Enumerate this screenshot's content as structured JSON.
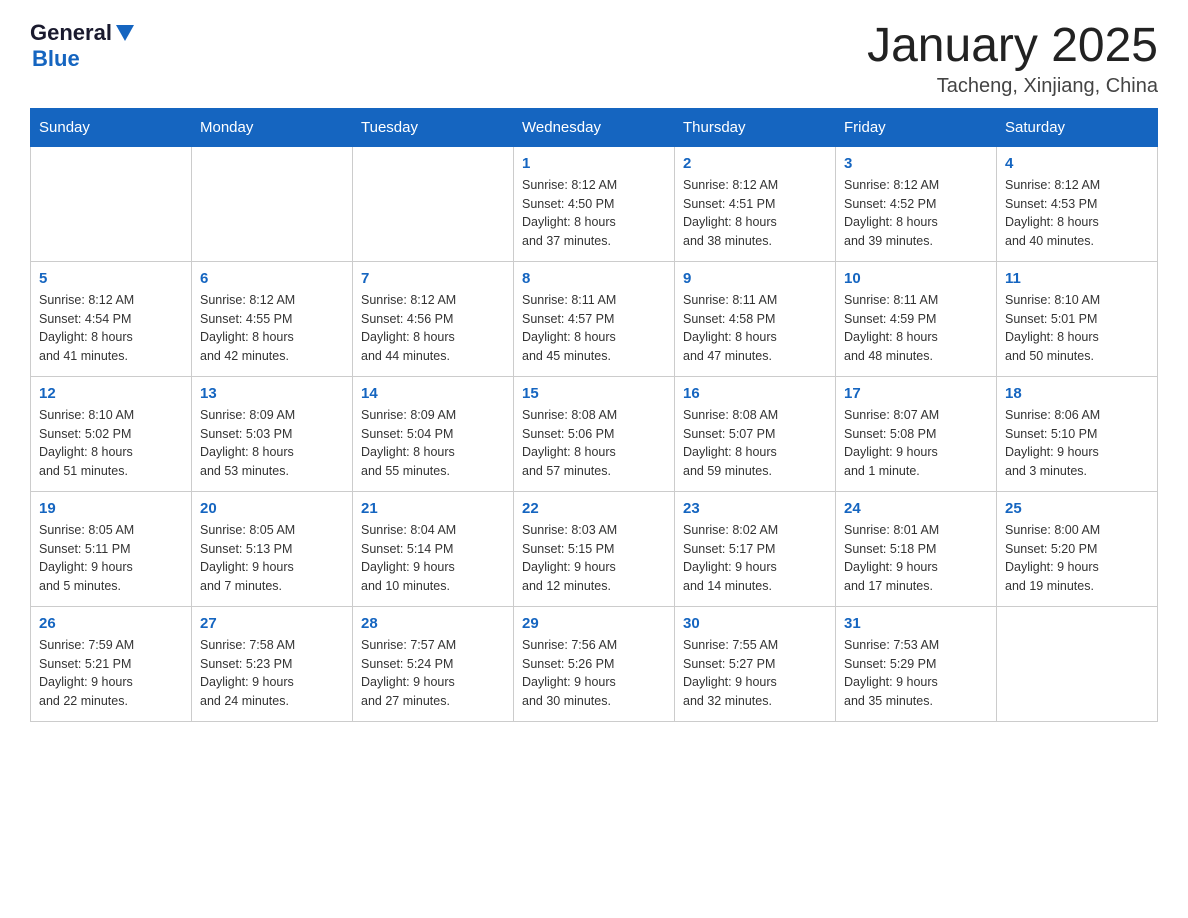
{
  "header": {
    "logo_general": "General",
    "logo_blue": "Blue",
    "title": "January 2025",
    "subtitle": "Tacheng, Xinjiang, China"
  },
  "days_of_week": [
    "Sunday",
    "Monday",
    "Tuesday",
    "Wednesday",
    "Thursday",
    "Friday",
    "Saturday"
  ],
  "weeks": [
    {
      "days": [
        {
          "number": "",
          "info": ""
        },
        {
          "number": "",
          "info": ""
        },
        {
          "number": "",
          "info": ""
        },
        {
          "number": "1",
          "info": "Sunrise: 8:12 AM\nSunset: 4:50 PM\nDaylight: 8 hours\nand 37 minutes."
        },
        {
          "number": "2",
          "info": "Sunrise: 8:12 AM\nSunset: 4:51 PM\nDaylight: 8 hours\nand 38 minutes."
        },
        {
          "number": "3",
          "info": "Sunrise: 8:12 AM\nSunset: 4:52 PM\nDaylight: 8 hours\nand 39 minutes."
        },
        {
          "number": "4",
          "info": "Sunrise: 8:12 AM\nSunset: 4:53 PM\nDaylight: 8 hours\nand 40 minutes."
        }
      ]
    },
    {
      "days": [
        {
          "number": "5",
          "info": "Sunrise: 8:12 AM\nSunset: 4:54 PM\nDaylight: 8 hours\nand 41 minutes."
        },
        {
          "number": "6",
          "info": "Sunrise: 8:12 AM\nSunset: 4:55 PM\nDaylight: 8 hours\nand 42 minutes."
        },
        {
          "number": "7",
          "info": "Sunrise: 8:12 AM\nSunset: 4:56 PM\nDaylight: 8 hours\nand 44 minutes."
        },
        {
          "number": "8",
          "info": "Sunrise: 8:11 AM\nSunset: 4:57 PM\nDaylight: 8 hours\nand 45 minutes."
        },
        {
          "number": "9",
          "info": "Sunrise: 8:11 AM\nSunset: 4:58 PM\nDaylight: 8 hours\nand 47 minutes."
        },
        {
          "number": "10",
          "info": "Sunrise: 8:11 AM\nSunset: 4:59 PM\nDaylight: 8 hours\nand 48 minutes."
        },
        {
          "number": "11",
          "info": "Sunrise: 8:10 AM\nSunset: 5:01 PM\nDaylight: 8 hours\nand 50 minutes."
        }
      ]
    },
    {
      "days": [
        {
          "number": "12",
          "info": "Sunrise: 8:10 AM\nSunset: 5:02 PM\nDaylight: 8 hours\nand 51 minutes."
        },
        {
          "number": "13",
          "info": "Sunrise: 8:09 AM\nSunset: 5:03 PM\nDaylight: 8 hours\nand 53 minutes."
        },
        {
          "number": "14",
          "info": "Sunrise: 8:09 AM\nSunset: 5:04 PM\nDaylight: 8 hours\nand 55 minutes."
        },
        {
          "number": "15",
          "info": "Sunrise: 8:08 AM\nSunset: 5:06 PM\nDaylight: 8 hours\nand 57 minutes."
        },
        {
          "number": "16",
          "info": "Sunrise: 8:08 AM\nSunset: 5:07 PM\nDaylight: 8 hours\nand 59 minutes."
        },
        {
          "number": "17",
          "info": "Sunrise: 8:07 AM\nSunset: 5:08 PM\nDaylight: 9 hours\nand 1 minute."
        },
        {
          "number": "18",
          "info": "Sunrise: 8:06 AM\nSunset: 5:10 PM\nDaylight: 9 hours\nand 3 minutes."
        }
      ]
    },
    {
      "days": [
        {
          "number": "19",
          "info": "Sunrise: 8:05 AM\nSunset: 5:11 PM\nDaylight: 9 hours\nand 5 minutes."
        },
        {
          "number": "20",
          "info": "Sunrise: 8:05 AM\nSunset: 5:13 PM\nDaylight: 9 hours\nand 7 minutes."
        },
        {
          "number": "21",
          "info": "Sunrise: 8:04 AM\nSunset: 5:14 PM\nDaylight: 9 hours\nand 10 minutes."
        },
        {
          "number": "22",
          "info": "Sunrise: 8:03 AM\nSunset: 5:15 PM\nDaylight: 9 hours\nand 12 minutes."
        },
        {
          "number": "23",
          "info": "Sunrise: 8:02 AM\nSunset: 5:17 PM\nDaylight: 9 hours\nand 14 minutes."
        },
        {
          "number": "24",
          "info": "Sunrise: 8:01 AM\nSunset: 5:18 PM\nDaylight: 9 hours\nand 17 minutes."
        },
        {
          "number": "25",
          "info": "Sunrise: 8:00 AM\nSunset: 5:20 PM\nDaylight: 9 hours\nand 19 minutes."
        }
      ]
    },
    {
      "days": [
        {
          "number": "26",
          "info": "Sunrise: 7:59 AM\nSunset: 5:21 PM\nDaylight: 9 hours\nand 22 minutes."
        },
        {
          "number": "27",
          "info": "Sunrise: 7:58 AM\nSunset: 5:23 PM\nDaylight: 9 hours\nand 24 minutes."
        },
        {
          "number": "28",
          "info": "Sunrise: 7:57 AM\nSunset: 5:24 PM\nDaylight: 9 hours\nand 27 minutes."
        },
        {
          "number": "29",
          "info": "Sunrise: 7:56 AM\nSunset: 5:26 PM\nDaylight: 9 hours\nand 30 minutes."
        },
        {
          "number": "30",
          "info": "Sunrise: 7:55 AM\nSunset: 5:27 PM\nDaylight: 9 hours\nand 32 minutes."
        },
        {
          "number": "31",
          "info": "Sunrise: 7:53 AM\nSunset: 5:29 PM\nDaylight: 9 hours\nand 35 minutes."
        },
        {
          "number": "",
          "info": ""
        }
      ]
    }
  ]
}
